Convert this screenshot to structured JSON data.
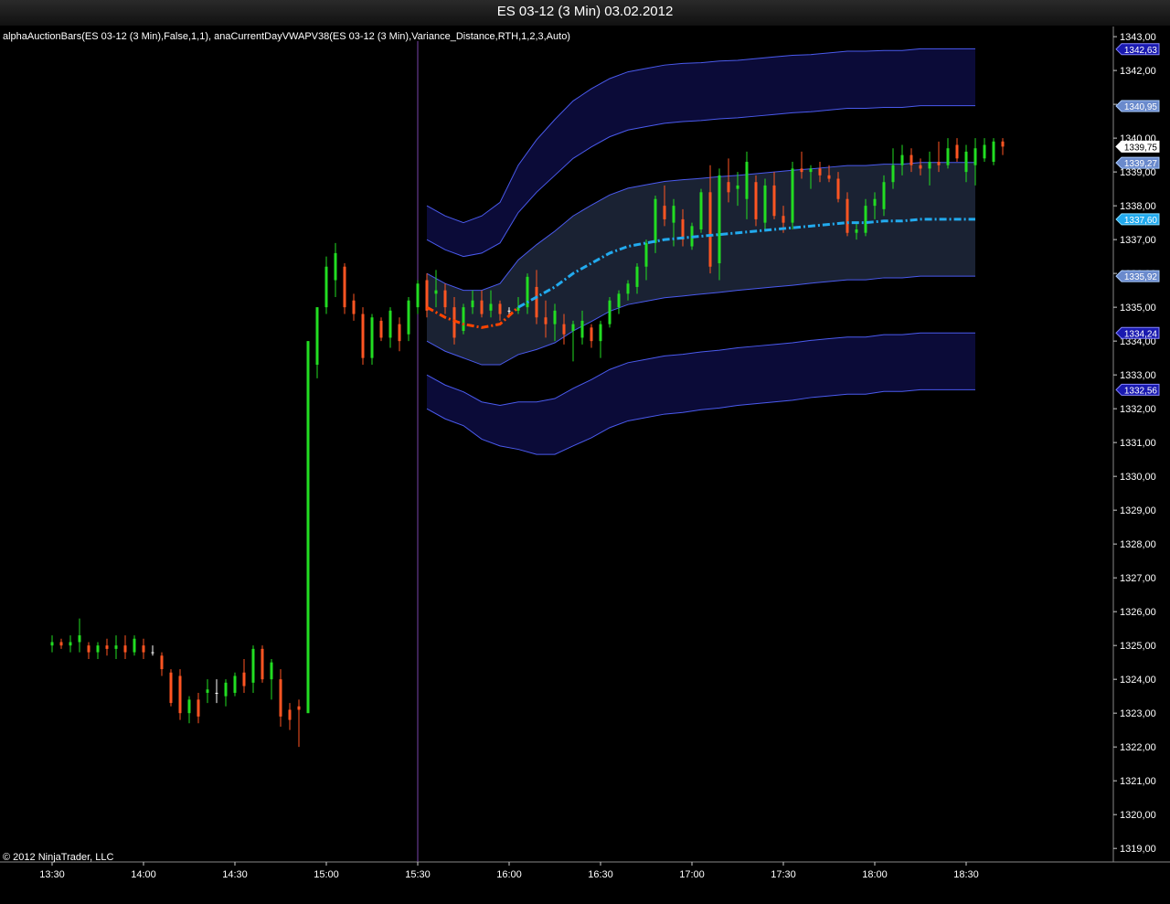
{
  "window": {
    "title": "ES 03-12 (3 Min)  03.02.2012"
  },
  "indicator_label": "alphaAuctionBars(ES 03-12 (3 Min),False,1,1), anaCurrentDayVWAPV38(ES 03-12 (3 Min),Variance_Distance,RTH,1,2,3,Auto)",
  "copyright": "© 2012 NinjaTrader, LLC",
  "colors": {
    "background": "#000000",
    "up_bar": "#22dd22",
    "down_bar": "#ff5522",
    "neutral_bar": "#ffffff",
    "vwap": "#22aaee",
    "vwap_pre": "#ff4400",
    "band_fill_inner": "#1a2233",
    "band_fill_outer": "#0b0b38",
    "band_line": "#4a5aee",
    "session_line": "#7744aa",
    "axis": "#888888"
  },
  "chart_data": {
    "type": "candlestick",
    "instrument": "ES 03-12",
    "interval": "3 Min",
    "date": "03.02.2012",
    "ylim": [
      1318.6,
      1343.3
    ],
    "y_ticks": [
      "1319,00",
      "1320,00",
      "1321,00",
      "1322,00",
      "1323,00",
      "1324,00",
      "1325,00",
      "1326,00",
      "1327,00",
      "1328,00",
      "1329,00",
      "1330,00",
      "1331,00",
      "1332,00",
      "1333,00",
      "1334,00",
      "1335,00",
      "1336,00",
      "1337,00",
      "1338,00",
      "1339,00",
      "1340,00",
      "1341,00",
      "1342,00",
      "1343,00"
    ],
    "x_ticks": [
      "13:30",
      "14:00",
      "14:30",
      "15:00",
      "15:30",
      "16:00",
      "16:30",
      "17:00",
      "17:30",
      "18:00",
      "18:30"
    ],
    "session_start": "15:30",
    "price_markers": [
      {
        "label": "1342,63",
        "value": 1342.63,
        "style": "blue"
      },
      {
        "label": "1340,95",
        "value": 1340.95,
        "style": "lightblue"
      },
      {
        "label": "1339,75",
        "value": 1339.75,
        "style": "white"
      },
      {
        "label": "1339,27",
        "value": 1339.27,
        "style": "lightblue"
      },
      {
        "label": "1337,60",
        "value": 1337.6,
        "style": "cyan"
      },
      {
        "label": "1335,92",
        "value": 1335.92,
        "style": "lightblue"
      },
      {
        "label": "1334,24",
        "value": 1334.24,
        "style": "blue"
      },
      {
        "label": "1332,56",
        "value": 1332.56,
        "style": "blue"
      }
    ],
    "bars": [
      {
        "t": "13:30",
        "o": 1325.0,
        "h": 1325.3,
        "l": 1324.8,
        "c": 1325.1
      },
      {
        "t": "13:33",
        "o": 1325.1,
        "h": 1325.2,
        "l": 1324.9,
        "c": 1325.0
      },
      {
        "t": "13:36",
        "o": 1325.0,
        "h": 1325.3,
        "l": 1324.8,
        "c": 1325.1
      },
      {
        "t": "13:39",
        "o": 1325.1,
        "h": 1325.8,
        "l": 1324.8,
        "c": 1325.3
      },
      {
        "t": "13:42",
        "o": 1325.0,
        "h": 1325.1,
        "l": 1324.6,
        "c": 1324.8
      },
      {
        "t": "13:45",
        "o": 1324.8,
        "h": 1325.1,
        "l": 1324.6,
        "c": 1325.0
      },
      {
        "t": "13:48",
        "o": 1325.0,
        "h": 1325.2,
        "l": 1324.7,
        "c": 1324.9
      },
      {
        "t": "13:51",
        "o": 1324.9,
        "h": 1325.3,
        "l": 1324.6,
        "c": 1325.0
      },
      {
        "t": "13:54",
        "o": 1325.0,
        "h": 1325.3,
        "l": 1324.6,
        "c": 1324.8
      },
      {
        "t": "13:57",
        "o": 1324.8,
        "h": 1325.3,
        "l": 1324.7,
        "c": 1325.2
      },
      {
        "t": "14:00",
        "o": 1325.0,
        "h": 1325.2,
        "l": 1324.6,
        "c": 1324.8
      },
      {
        "t": "14:03",
        "o": 1324.8,
        "h": 1325.0,
        "l": 1324.7,
        "c": 1324.8
      },
      {
        "t": "14:06",
        "o": 1324.7,
        "h": 1324.8,
        "l": 1324.1,
        "c": 1324.3
      },
      {
        "t": "14:09",
        "o": 1324.2,
        "h": 1324.3,
        "l": 1323.2,
        "c": 1323.3
      },
      {
        "t": "14:12",
        "o": 1324.1,
        "h": 1324.3,
        "l": 1322.8,
        "c": 1323.0
      },
      {
        "t": "14:15",
        "o": 1323.0,
        "h": 1323.5,
        "l": 1322.7,
        "c": 1323.4
      },
      {
        "t": "14:18",
        "o": 1323.4,
        "h": 1323.6,
        "l": 1322.7,
        "c": 1322.9
      },
      {
        "t": "14:21",
        "o": 1323.6,
        "h": 1324.0,
        "l": 1323.3,
        "c": 1323.7
      },
      {
        "t": "14:24",
        "o": 1323.6,
        "h": 1324.0,
        "l": 1323.3,
        "c": 1323.6
      },
      {
        "t": "14:27",
        "o": 1323.5,
        "h": 1324.0,
        "l": 1323.2,
        "c": 1323.9
      },
      {
        "t": "14:30",
        "o": 1323.6,
        "h": 1324.2,
        "l": 1323.5,
        "c": 1324.1
      },
      {
        "t": "14:33",
        "o": 1324.2,
        "h": 1324.6,
        "l": 1323.6,
        "c": 1323.8
      },
      {
        "t": "14:36",
        "o": 1323.9,
        "h": 1325.0,
        "l": 1323.6,
        "c": 1324.9
      },
      {
        "t": "14:39",
        "o": 1324.9,
        "h": 1325.0,
        "l": 1323.9,
        "c": 1324.0
      },
      {
        "t": "14:42",
        "o": 1324.0,
        "h": 1324.6,
        "l": 1323.4,
        "c": 1324.5
      },
      {
        "t": "14:45",
        "o": 1324.0,
        "h": 1324.3,
        "l": 1322.6,
        "c": 1322.9
      },
      {
        "t": "14:48",
        "o": 1323.1,
        "h": 1323.3,
        "l": 1322.5,
        "c": 1322.8
      },
      {
        "t": "14:51",
        "o": 1323.2,
        "h": 1323.4,
        "l": 1322.0,
        "c": 1323.1
      },
      {
        "t": "14:54",
        "o": 1323.0,
        "h": 1334.0,
        "l": 1323.0,
        "c": 1334.0
      },
      {
        "t": "14:57",
        "o": 1333.3,
        "h": 1335.0,
        "l": 1332.9,
        "c": 1335.0
      },
      {
        "t": "15:00",
        "o": 1335.0,
        "h": 1336.5,
        "l": 1334.8,
        "c": 1336.2
      },
      {
        "t": "15:03",
        "o": 1335.8,
        "h": 1336.9,
        "l": 1335.3,
        "c": 1336.6
      },
      {
        "t": "15:06",
        "o": 1336.2,
        "h": 1336.3,
        "l": 1334.8,
        "c": 1335.0
      },
      {
        "t": "15:09",
        "o": 1335.2,
        "h": 1335.4,
        "l": 1334.6,
        "c": 1334.8
      },
      {
        "t": "15:12",
        "o": 1334.8,
        "h": 1335.0,
        "l": 1333.3,
        "c": 1333.5
      },
      {
        "t": "15:15",
        "o": 1333.5,
        "h": 1334.8,
        "l": 1333.3,
        "c": 1334.7
      },
      {
        "t": "15:18",
        "o": 1334.6,
        "h": 1334.7,
        "l": 1334.0,
        "c": 1334.1
      },
      {
        "t": "15:21",
        "o": 1334.1,
        "h": 1335.0,
        "l": 1333.8,
        "c": 1334.9
      },
      {
        "t": "15:24",
        "o": 1334.5,
        "h": 1334.7,
        "l": 1333.7,
        "c": 1334.0
      },
      {
        "t": "15:27",
        "o": 1334.2,
        "h": 1335.3,
        "l": 1334.0,
        "c": 1335.2
      },
      {
        "t": "15:30",
        "o": 1335.0,
        "h": 1335.8,
        "l": 1334.8,
        "c": 1335.7
      },
      {
        "t": "15:33",
        "o": 1335.8,
        "h": 1336.0,
        "l": 1334.7,
        "c": 1334.9
      },
      {
        "t": "15:36",
        "o": 1335.4,
        "h": 1336.1,
        "l": 1335.0,
        "c": 1335.5
      },
      {
        "t": "15:39",
        "o": 1335.5,
        "h": 1335.7,
        "l": 1334.8,
        "c": 1335.0
      },
      {
        "t": "15:42",
        "o": 1335.0,
        "h": 1335.3,
        "l": 1333.9,
        "c": 1334.1
      },
      {
        "t": "15:45",
        "o": 1334.3,
        "h": 1335.1,
        "l": 1334.2,
        "c": 1335.0
      },
      {
        "t": "15:48",
        "o": 1335.0,
        "h": 1335.5,
        "l": 1334.8,
        "c": 1335.2
      },
      {
        "t": "15:51",
        "o": 1335.2,
        "h": 1335.5,
        "l": 1334.7,
        "c": 1334.8
      },
      {
        "t": "15:54",
        "o": 1334.9,
        "h": 1335.5,
        "l": 1334.7,
        "c": 1335.1
      },
      {
        "t": "15:57",
        "o": 1335.1,
        "h": 1335.2,
        "l": 1334.6,
        "c": 1334.8
      },
      {
        "t": "16:00",
        "o": 1334.9,
        "h": 1335.0,
        "l": 1334.7,
        "c": 1334.9
      },
      {
        "t": "16:03",
        "o": 1334.9,
        "h": 1335.3,
        "l": 1334.8,
        "c": 1335.0
      },
      {
        "t": "16:06",
        "o": 1335.0,
        "h": 1336.0,
        "l": 1334.8,
        "c": 1335.9
      },
      {
        "t": "16:09",
        "o": 1335.6,
        "h": 1336.1,
        "l": 1334.5,
        "c": 1334.7
      },
      {
        "t": "16:12",
        "o": 1334.7,
        "h": 1335.2,
        "l": 1334.1,
        "c": 1334.5
      },
      {
        "t": "16:15",
        "o": 1334.5,
        "h": 1335.1,
        "l": 1334.0,
        "c": 1334.9
      },
      {
        "t": "16:18",
        "o": 1334.5,
        "h": 1334.8,
        "l": 1333.9,
        "c": 1334.2
      },
      {
        "t": "16:21",
        "o": 1334.3,
        "h": 1334.6,
        "l": 1333.4,
        "c": 1334.5
      },
      {
        "t": "16:24",
        "o": 1334.1,
        "h": 1334.9,
        "l": 1333.9,
        "c": 1334.6
      },
      {
        "t": "16:27",
        "o": 1334.4,
        "h": 1334.5,
        "l": 1333.8,
        "c": 1334.0
      },
      {
        "t": "16:30",
        "o": 1334.0,
        "h": 1334.6,
        "l": 1333.5,
        "c": 1334.5
      },
      {
        "t": "16:33",
        "o": 1334.5,
        "h": 1335.3,
        "l": 1334.4,
        "c": 1335.2
      },
      {
        "t": "16:36",
        "o": 1335.0,
        "h": 1335.5,
        "l": 1334.8,
        "c": 1335.4
      },
      {
        "t": "16:39",
        "o": 1335.4,
        "h": 1335.8,
        "l": 1335.2,
        "c": 1335.7
      },
      {
        "t": "16:42",
        "o": 1335.6,
        "h": 1336.3,
        "l": 1335.4,
        "c": 1336.2
      },
      {
        "t": "16:45",
        "o": 1336.2,
        "h": 1337.0,
        "l": 1335.8,
        "c": 1336.9
      },
      {
        "t": "16:48",
        "o": 1336.9,
        "h": 1338.3,
        "l": 1336.6,
        "c": 1338.2
      },
      {
        "t": "16:51",
        "o": 1338.0,
        "h": 1338.6,
        "l": 1337.4,
        "c": 1337.6
      },
      {
        "t": "16:54",
        "o": 1337.5,
        "h": 1338.2,
        "l": 1336.8,
        "c": 1338.0
      },
      {
        "t": "16:57",
        "o": 1337.6,
        "h": 1337.9,
        "l": 1336.8,
        "c": 1337.0
      },
      {
        "t": "17:00",
        "o": 1336.8,
        "h": 1337.5,
        "l": 1336.7,
        "c": 1337.4
      },
      {
        "t": "17:03",
        "o": 1337.3,
        "h": 1338.5,
        "l": 1337.2,
        "c": 1338.4
      },
      {
        "t": "17:06",
        "o": 1338.4,
        "h": 1339.2,
        "l": 1336.0,
        "c": 1336.2
      },
      {
        "t": "17:09",
        "o": 1336.3,
        "h": 1339.1,
        "l": 1335.8,
        "c": 1338.9
      },
      {
        "t": "17:12",
        "o": 1338.7,
        "h": 1339.4,
        "l": 1338.1,
        "c": 1338.4
      },
      {
        "t": "17:15",
        "o": 1338.5,
        "h": 1339.0,
        "l": 1338.0,
        "c": 1338.6
      },
      {
        "t": "17:18",
        "o": 1338.2,
        "h": 1339.6,
        "l": 1337.6,
        "c": 1339.3
      },
      {
        "t": "17:21",
        "o": 1338.7,
        "h": 1338.9,
        "l": 1337.4,
        "c": 1337.6
      },
      {
        "t": "17:24",
        "o": 1337.5,
        "h": 1338.8,
        "l": 1337.3,
        "c": 1338.6
      },
      {
        "t": "17:27",
        "o": 1338.6,
        "h": 1339.0,
        "l": 1337.6,
        "c": 1337.7
      },
      {
        "t": "17:30",
        "o": 1337.7,
        "h": 1338.0,
        "l": 1337.2,
        "c": 1337.5
      },
      {
        "t": "17:33",
        "o": 1337.5,
        "h": 1339.3,
        "l": 1337.3,
        "c": 1339.1
      },
      {
        "t": "17:36",
        "o": 1339.1,
        "h": 1339.6,
        "l": 1338.8,
        "c": 1339.0
      },
      {
        "t": "17:39",
        "o": 1339.0,
        "h": 1339.2,
        "l": 1338.5,
        "c": 1339.1
      },
      {
        "t": "17:42",
        "o": 1339.1,
        "h": 1339.3,
        "l": 1338.7,
        "c": 1338.9
      },
      {
        "t": "17:45",
        "o": 1338.9,
        "h": 1339.2,
        "l": 1338.7,
        "c": 1338.8
      },
      {
        "t": "17:48",
        "o": 1338.8,
        "h": 1339.0,
        "l": 1338.1,
        "c": 1338.2
      },
      {
        "t": "17:51",
        "o": 1338.2,
        "h": 1338.4,
        "l": 1337.1,
        "c": 1337.2
      },
      {
        "t": "17:54",
        "o": 1337.2,
        "h": 1337.5,
        "l": 1337.0,
        "c": 1337.3
      },
      {
        "t": "17:57",
        "o": 1337.2,
        "h": 1338.2,
        "l": 1337.1,
        "c": 1338.0
      },
      {
        "t": "18:00",
        "o": 1338.0,
        "h": 1338.4,
        "l": 1337.6,
        "c": 1338.2
      },
      {
        "t": "18:03",
        "o": 1337.9,
        "h": 1338.9,
        "l": 1337.7,
        "c": 1338.7
      },
      {
        "t": "18:06",
        "o": 1338.7,
        "h": 1339.7,
        "l": 1338.5,
        "c": 1339.2
      },
      {
        "t": "18:09",
        "o": 1339.2,
        "h": 1339.8,
        "l": 1338.9,
        "c": 1339.5
      },
      {
        "t": "18:12",
        "o": 1339.5,
        "h": 1339.7,
        "l": 1339.0,
        "c": 1339.2
      },
      {
        "t": "18:15",
        "o": 1339.2,
        "h": 1339.4,
        "l": 1338.9,
        "c": 1339.1
      },
      {
        "t": "18:18",
        "o": 1339.1,
        "h": 1339.6,
        "l": 1338.6,
        "c": 1339.3
      },
      {
        "t": "18:21",
        "o": 1339.3,
        "h": 1339.9,
        "l": 1339.0,
        "c": 1339.2
      },
      {
        "t": "18:24",
        "o": 1339.2,
        "h": 1340.0,
        "l": 1339.1,
        "c": 1339.7
      },
      {
        "t": "18:27",
        "o": 1339.8,
        "h": 1340.0,
        "l": 1339.3,
        "c": 1339.4
      },
      {
        "t": "18:30",
        "o": 1339.0,
        "h": 1339.8,
        "l": 1338.7,
        "c": 1339.6
      },
      {
        "t": "18:33",
        "o": 1339.2,
        "h": 1340.0,
        "l": 1338.6,
        "c": 1339.7
      },
      {
        "t": "18:36",
        "o": 1339.4,
        "h": 1340.0,
        "l": 1339.3,
        "c": 1339.8
      },
      {
        "t": "18:39",
        "o": 1339.3,
        "h": 1340.0,
        "l": 1339.2,
        "c": 1339.9
      },
      {
        "t": "18:42",
        "o": 1339.9,
        "h": 1340.0,
        "l": 1339.5,
        "c": 1339.75
      }
    ],
    "vwap": {
      "times": [
        "15:30",
        "15:36",
        "15:42",
        "15:48",
        "15:54",
        "16:00",
        "16:06",
        "16:12",
        "16:18",
        "16:24",
        "16:30",
        "16:36",
        "16:42",
        "16:48",
        "16:54",
        "17:00",
        "17:06",
        "17:12",
        "17:18",
        "17:24",
        "17:30",
        "17:36",
        "17:42",
        "17:48",
        "17:54",
        "18:00",
        "18:06",
        "18:12",
        "18:18",
        "18:24",
        "18:30"
      ],
      "mid": [
        1335.0,
        1334.7,
        1334.5,
        1334.4,
        1334.5,
        1335.0,
        1335.3,
        1335.6,
        1336.0,
        1336.3,
        1336.6,
        1336.8,
        1336.9,
        1337.0,
        1337.05,
        1337.1,
        1337.15,
        1337.2,
        1337.25,
        1337.3,
        1337.35,
        1337.4,
        1337.45,
        1337.5,
        1337.5,
        1337.55,
        1337.55,
        1337.6,
        1337.6,
        1337.6,
        1337.6
      ],
      "sd1": [
        1.0,
        1.0,
        1.0,
        1.1,
        1.2,
        1.4,
        1.55,
        1.65,
        1.7,
        1.72,
        1.72,
        1.72,
        1.72,
        1.72,
        1.72,
        1.71,
        1.71,
        1.7,
        1.7,
        1.7,
        1.7,
        1.69,
        1.69,
        1.69,
        1.69,
        1.68,
        1.68,
        1.68,
        1.68,
        1.68,
        1.68
      ],
      "pre_until": "15:57"
    }
  }
}
